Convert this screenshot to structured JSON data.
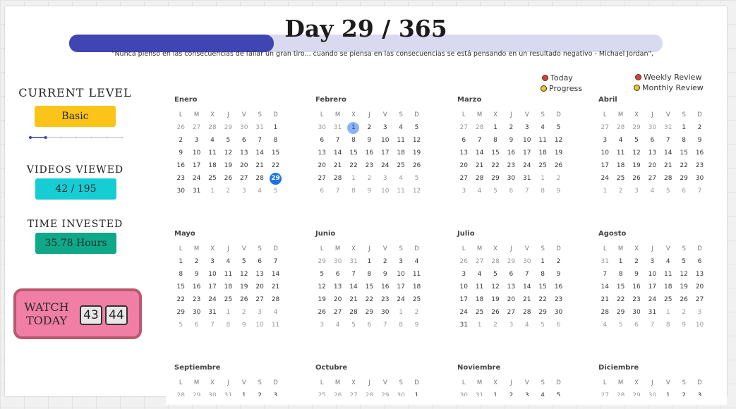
{
  "header": {
    "title": "Day 29 / 365",
    "progress": 0.345,
    "quote": "\"Nunca pienso en las consecuencias de fallar un gran tiro... cuando se piensa en las consecuencias se está pensando en un resultado negativo - Michael Jordan\","
  },
  "legend": [
    {
      "label": "Today",
      "color": "#e0402f"
    },
    {
      "label": "Progress",
      "color": "#f3c61c"
    },
    {
      "label": "Weekly Review",
      "color": "#e0402f"
    },
    {
      "label": "Monthly Review",
      "color": "#f3c61c"
    }
  ],
  "sidebar": {
    "level_heading": "CURRENT LEVEL",
    "level_value": "Basic",
    "level_step": 2,
    "level_steps": 7,
    "videos_heading": "VIDEOS VIEWED",
    "videos_value": "42 / 195",
    "time_heading": "TIME INVESTED",
    "time_value": "35.78 Hours",
    "watch_label": "WATCH TODAY",
    "watch_values": [
      "43",
      "44"
    ]
  },
  "colors": {
    "accent": "#3f45b3",
    "level_pill": "#fcc419",
    "videos_pill": "#17cdd4",
    "time_pill": "#0fa889",
    "today_circle": "#1a73e8",
    "selected_circle": "#8ab4f8"
  },
  "weekday_headers": [
    "L",
    "M",
    "X",
    "J",
    "V",
    "S",
    "D"
  ],
  "calendar": [
    {
      "name": "Enero",
      "days": [
        "26",
        "27",
        "28",
        "29",
        "30",
        "31",
        "1",
        "2",
        "3",
        "4",
        "5",
        "6",
        "7",
        "8",
        "9",
        "10",
        "11",
        "12",
        "13",
        "14",
        "15",
        "16",
        "17",
        "18",
        "19",
        "20",
        "21",
        "22",
        "23",
        "24",
        "25",
        "26",
        "27",
        "28",
        "29",
        "30",
        "31",
        "1",
        "2",
        "3",
        "4",
        "5"
      ],
      "lead": 6,
      "count": 31,
      "today": 29
    },
    {
      "name": "Febrero",
      "days": [
        "30",
        "31",
        "1",
        "2",
        "3",
        "4",
        "5",
        "6",
        "7",
        "8",
        "9",
        "10",
        "11",
        "12",
        "13",
        "14",
        "15",
        "16",
        "17",
        "18",
        "19",
        "20",
        "21",
        "22",
        "23",
        "24",
        "25",
        "26",
        "27",
        "28",
        "1",
        "2",
        "3",
        "4",
        "5",
        "6",
        "7",
        "8",
        "9",
        "10",
        "11",
        "12"
      ],
      "lead": 2,
      "count": 28,
      "selected": 1
    },
    {
      "name": "Marzo",
      "days": [
        "27",
        "28",
        "1",
        "2",
        "3",
        "4",
        "5",
        "6",
        "7",
        "8",
        "9",
        "10",
        "11",
        "12",
        "13",
        "14",
        "15",
        "16",
        "17",
        "18",
        "19",
        "20",
        "21",
        "22",
        "23",
        "24",
        "25",
        "26",
        "27",
        "28",
        "29",
        "30",
        "31",
        "1",
        "2",
        "3",
        "4",
        "5",
        "6",
        "7",
        "8",
        "9"
      ],
      "lead": 2,
      "count": 31
    },
    {
      "name": "Abril",
      "days": [
        "27",
        "28",
        "29",
        "30",
        "31",
        "1",
        "2",
        "3",
        "4",
        "5",
        "6",
        "7",
        "8",
        "9",
        "10",
        "11",
        "12",
        "13",
        "14",
        "15",
        "16",
        "17",
        "18",
        "19",
        "20",
        "21",
        "22",
        "23",
        "24",
        "25",
        "26",
        "27",
        "28",
        "29",
        "30",
        "1",
        "2",
        "3",
        "4",
        "5",
        "6",
        "7"
      ],
      "lead": 5,
      "count": 30
    },
    {
      "name": "Mayo",
      "days": [
        "1",
        "2",
        "3",
        "4",
        "5",
        "6",
        "7",
        "8",
        "9",
        "10",
        "11",
        "12",
        "13",
        "14",
        "15",
        "16",
        "17",
        "18",
        "19",
        "20",
        "21",
        "22",
        "23",
        "24",
        "25",
        "26",
        "27",
        "28",
        "29",
        "30",
        "31",
        "1",
        "2",
        "3",
        "4",
        "5",
        "6",
        "7",
        "8",
        "9",
        "10",
        "11"
      ],
      "lead": 0,
      "count": 31
    },
    {
      "name": "Junio",
      "days": [
        "29",
        "30",
        "31",
        "1",
        "2",
        "3",
        "4",
        "5",
        "6",
        "7",
        "8",
        "9",
        "10",
        "11",
        "12",
        "13",
        "14",
        "15",
        "16",
        "17",
        "18",
        "19",
        "20",
        "21",
        "22",
        "23",
        "24",
        "25",
        "26",
        "27",
        "28",
        "29",
        "30",
        "1",
        "2",
        "3",
        "4",
        "5",
        "6",
        "7",
        "8",
        "9"
      ],
      "lead": 3,
      "count": 30
    },
    {
      "name": "Julio",
      "days": [
        "26",
        "27",
        "28",
        "29",
        "30",
        "1",
        "2",
        "3",
        "4",
        "5",
        "6",
        "7",
        "8",
        "9",
        "10",
        "11",
        "12",
        "13",
        "14",
        "15",
        "16",
        "17",
        "18",
        "19",
        "20",
        "21",
        "22",
        "23",
        "24",
        "25",
        "26",
        "27",
        "28",
        "29",
        "30",
        "31",
        "1",
        "2",
        "3",
        "4",
        "5",
        "6"
      ],
      "lead": 5,
      "count": 31
    },
    {
      "name": "Agosto",
      "days": [
        "31",
        "1",
        "2",
        "3",
        "4",
        "5",
        "6",
        "7",
        "8",
        "9",
        "10",
        "11",
        "12",
        "13",
        "14",
        "15",
        "16",
        "17",
        "18",
        "19",
        "20",
        "21",
        "22",
        "23",
        "24",
        "25",
        "26",
        "27",
        "28",
        "29",
        "30",
        "31",
        "1",
        "2",
        "3",
        "4",
        "5",
        "6",
        "7",
        "8",
        "9",
        "10"
      ],
      "lead": 1,
      "count": 31
    },
    {
      "name": "Septiembre",
      "days": [
        "28",
        "29",
        "30",
        "31",
        "1",
        "2",
        "3"
      ],
      "lead": 4,
      "count": 30
    },
    {
      "name": "Octubre",
      "days": [
        "25",
        "26",
        "27",
        "28",
        "29",
        "30",
        "1"
      ],
      "lead": 6,
      "count": 31
    },
    {
      "name": "Noviembre",
      "days": [
        "30",
        "31",
        "1",
        "2",
        "3",
        "4",
        "5"
      ],
      "lead": 2,
      "count": 30
    },
    {
      "name": "Diciembre",
      "days": [
        "27",
        "28",
        "29",
        "30",
        "1",
        "2",
        "3"
      ],
      "lead": 4,
      "count": 31
    }
  ]
}
